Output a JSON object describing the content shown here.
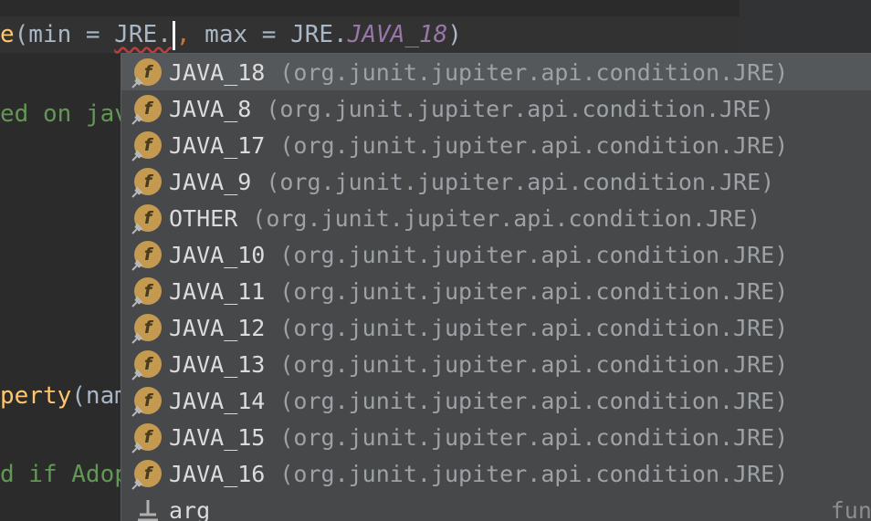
{
  "editor": {
    "line1": {
      "prefix_fn": "e",
      "open": "(min = ",
      "typed": "JRE.",
      "comma": ",",
      "rest": " max = JRE.",
      "const": "JAVA_18",
      "close": ")"
    },
    "line2": "ed on jav",
    "line3_fn": "perty",
    "line3_rest": "(nam",
    "line4": "d if Adop"
  },
  "completion": {
    "items": [
      {
        "name": "JAVA_18",
        "pkg": "(org.junit.jupiter.api.condition.JRE)"
      },
      {
        "name": "JAVA_8",
        "pkg": "(org.junit.jupiter.api.condition.JRE)"
      },
      {
        "name": "JAVA_17",
        "pkg": "(org.junit.jupiter.api.condition.JRE)"
      },
      {
        "name": "JAVA_9",
        "pkg": "(org.junit.jupiter.api.condition.JRE)"
      },
      {
        "name": "OTHER",
        "pkg": "(org.junit.jupiter.api.condition.JRE)"
      },
      {
        "name": "JAVA_10",
        "pkg": "(org.junit.jupiter.api.condition.JRE)"
      },
      {
        "name": "JAVA_11",
        "pkg": "(org.junit.jupiter.api.condition.JRE)"
      },
      {
        "name": "JAVA_12",
        "pkg": "(org.junit.jupiter.api.condition.JRE)"
      },
      {
        "name": "JAVA_13",
        "pkg": "(org.junit.jupiter.api.condition.JRE)"
      },
      {
        "name": "JAVA_14",
        "pkg": "(org.junit.jupiter.api.condition.JRE)"
      },
      {
        "name": "JAVA_15",
        "pkg": "(org.junit.jupiter.api.condition.JRE)"
      },
      {
        "name": "JAVA_16",
        "pkg": "(org.junit.jupiter.api.condition.JRE)"
      }
    ],
    "field_icon_letter": "f",
    "last_item": {
      "name": "arg",
      "tail": "funct"
    }
  }
}
